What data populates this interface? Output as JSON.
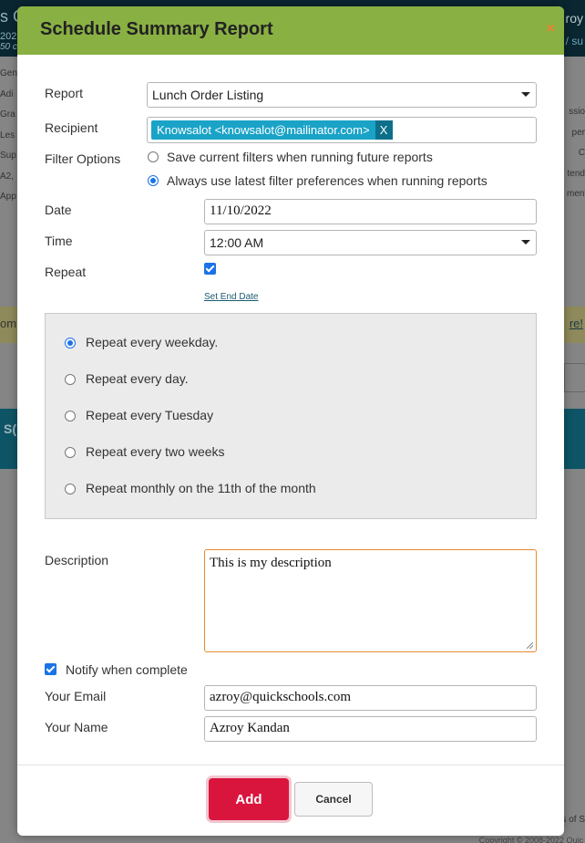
{
  "background": {
    "top_left_1": "s C",
    "top_left_2": "202",
    "top_left_3": "50 c",
    "top_right_1": "roy",
    "top_right_2": "/ su",
    "left_items": [
      "Gen",
      "Adi",
      "Gra",
      "Les",
      "Sup",
      "A2,",
      "App"
    ],
    "right_items": [
      "ssio",
      "per C",
      "tend",
      "ment"
    ],
    "stripe_left": "om",
    "stripe_right": "re!",
    "teal_left": "S(",
    "footer_right": "s of S",
    "copyright": "Copyright © 2008-2022 Quic"
  },
  "modal": {
    "title": "Schedule Summary Report",
    "close_label": "×",
    "report": {
      "label": "Report",
      "value": "Lunch Order Listing"
    },
    "recipient": {
      "label": "Recipient",
      "tag": "Knowsalot <knowsalot@mailinator.com>",
      "tag_remove": "X"
    },
    "filter": {
      "label": "Filter Options",
      "options": [
        "Save current filters when running future reports",
        "Always use latest filter preferences when running reports"
      ],
      "selected_index": 1
    },
    "date": {
      "label": "Date",
      "value": "11/10/2022"
    },
    "time": {
      "label": "Time",
      "value": "12:00 AM"
    },
    "repeat": {
      "label": "Repeat",
      "checked": true,
      "set_end_date": "Set End Date"
    },
    "repeat_options": [
      "Repeat every weekday.",
      "Repeat every day.",
      "Repeat every Tuesday",
      "Repeat every two weeks",
      "Repeat monthly on the 11th of the month"
    ],
    "repeat_selected_index": 0,
    "description": {
      "label": "Description",
      "value": "This is my description"
    },
    "notify": {
      "label": "Notify when complete",
      "checked": true
    },
    "email": {
      "label": "Your Email",
      "value": "azroy@quickschools.com"
    },
    "name": {
      "label": "Your Name",
      "value": "Azroy Kandan"
    },
    "buttons": {
      "add": "Add",
      "cancel": "Cancel"
    }
  },
  "colors": {
    "header": "#89b043",
    "accent_blue": "#1a73e8",
    "tag": "#1aa3c7",
    "add_button": "#d9153e",
    "description_border": "#e58a2c"
  }
}
